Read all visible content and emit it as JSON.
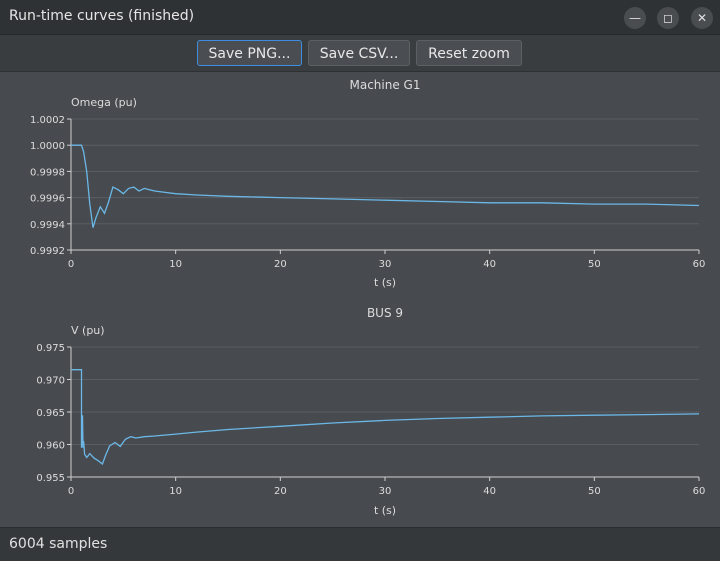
{
  "window": {
    "title": "Run-time curves (finished)",
    "controls": [
      "minimize-icon",
      "maximize-icon",
      "close-icon"
    ]
  },
  "toolbar": {
    "save_png_label": "Save PNG...",
    "save_csv_label": "Save CSV...",
    "reset_zoom_label": "Reset zoom"
  },
  "status": {
    "text": "6004 samples"
  },
  "colors": {
    "curve": "#6bb8e8",
    "grid": "#5a5e62",
    "axis": "#d0d0d0"
  },
  "chart_data": [
    {
      "type": "line",
      "title": "Machine G1",
      "xlabel": "t (s)",
      "ylabel": "Omega (pu)",
      "xlim": [
        0,
        60
      ],
      "ylim": [
        0.9992,
        1.0002
      ],
      "xticks": [
        0,
        10,
        20,
        30,
        40,
        50,
        60
      ],
      "yticks": [
        0.9992,
        0.9994,
        0.9996,
        0.9998,
        1.0,
        1.0002
      ],
      "ytick_labels": [
        "0.9992",
        "0.9994",
        "0.9996",
        "0.9998",
        "1.0000",
        "1.0002"
      ],
      "grid": true,
      "series": [
        {
          "x": [
            0,
            1.0,
            1.2,
            1.5,
            1.8,
            2.1,
            2.4,
            2.8,
            3.2,
            3.6,
            4.0,
            4.5,
            5.0,
            5.5,
            6.0,
            6.5,
            7.0,
            7.5,
            8.0,
            9.0,
            10,
            12,
            15,
            20,
            25,
            30,
            35,
            40,
            45,
            50,
            55,
            60
          ],
          "y": [
            1.0,
            1.0,
            0.99995,
            0.9998,
            0.99955,
            0.99937,
            0.99945,
            0.99953,
            0.99948,
            0.99957,
            0.99968,
            0.99966,
            0.99963,
            0.99967,
            0.99968,
            0.99965,
            0.99967,
            0.99966,
            0.99965,
            0.99964,
            0.99963,
            0.99962,
            0.99961,
            0.9996,
            0.99959,
            0.99958,
            0.99957,
            0.99956,
            0.99956,
            0.99955,
            0.99955,
            0.99954
          ]
        }
      ]
    },
    {
      "type": "line",
      "title": "BUS 9",
      "xlabel": "t (s)",
      "ylabel": "V (pu)",
      "xlim": [
        0,
        60
      ],
      "ylim": [
        0.955,
        0.975
      ],
      "xticks": [
        0,
        10,
        20,
        30,
        40,
        50,
        60
      ],
      "yticks": [
        0.955,
        0.96,
        0.965,
        0.97,
        0.975
      ],
      "ytick_labels": [
        "0.955",
        "0.960",
        "0.965",
        "0.970",
        "0.975"
      ],
      "grid": true,
      "series": [
        {
          "x": [
            0,
            1.0,
            1.0,
            1.1,
            1.15,
            1.2,
            1.3,
            1.5,
            1.8,
            2.2,
            2.6,
            3.0,
            3.3,
            3.7,
            4.2,
            4.7,
            5.2,
            5.7,
            6.2,
            7.0,
            8.0,
            10,
            12,
            15,
            20,
            25,
            30,
            35,
            40,
            45,
            50,
            55,
            60
          ],
          "y": [
            0.9715,
            0.9715,
            0.9595,
            0.9645,
            0.9595,
            0.9605,
            0.9585,
            0.958,
            0.9586,
            0.9579,
            0.9575,
            0.957,
            0.9583,
            0.9598,
            0.9603,
            0.9597,
            0.9608,
            0.9612,
            0.961,
            0.9612,
            0.9613,
            0.9616,
            0.9619,
            0.9623,
            0.9628,
            0.9633,
            0.9637,
            0.964,
            0.9642,
            0.9644,
            0.9645,
            0.9646,
            0.9647
          ]
        }
      ]
    }
  ]
}
